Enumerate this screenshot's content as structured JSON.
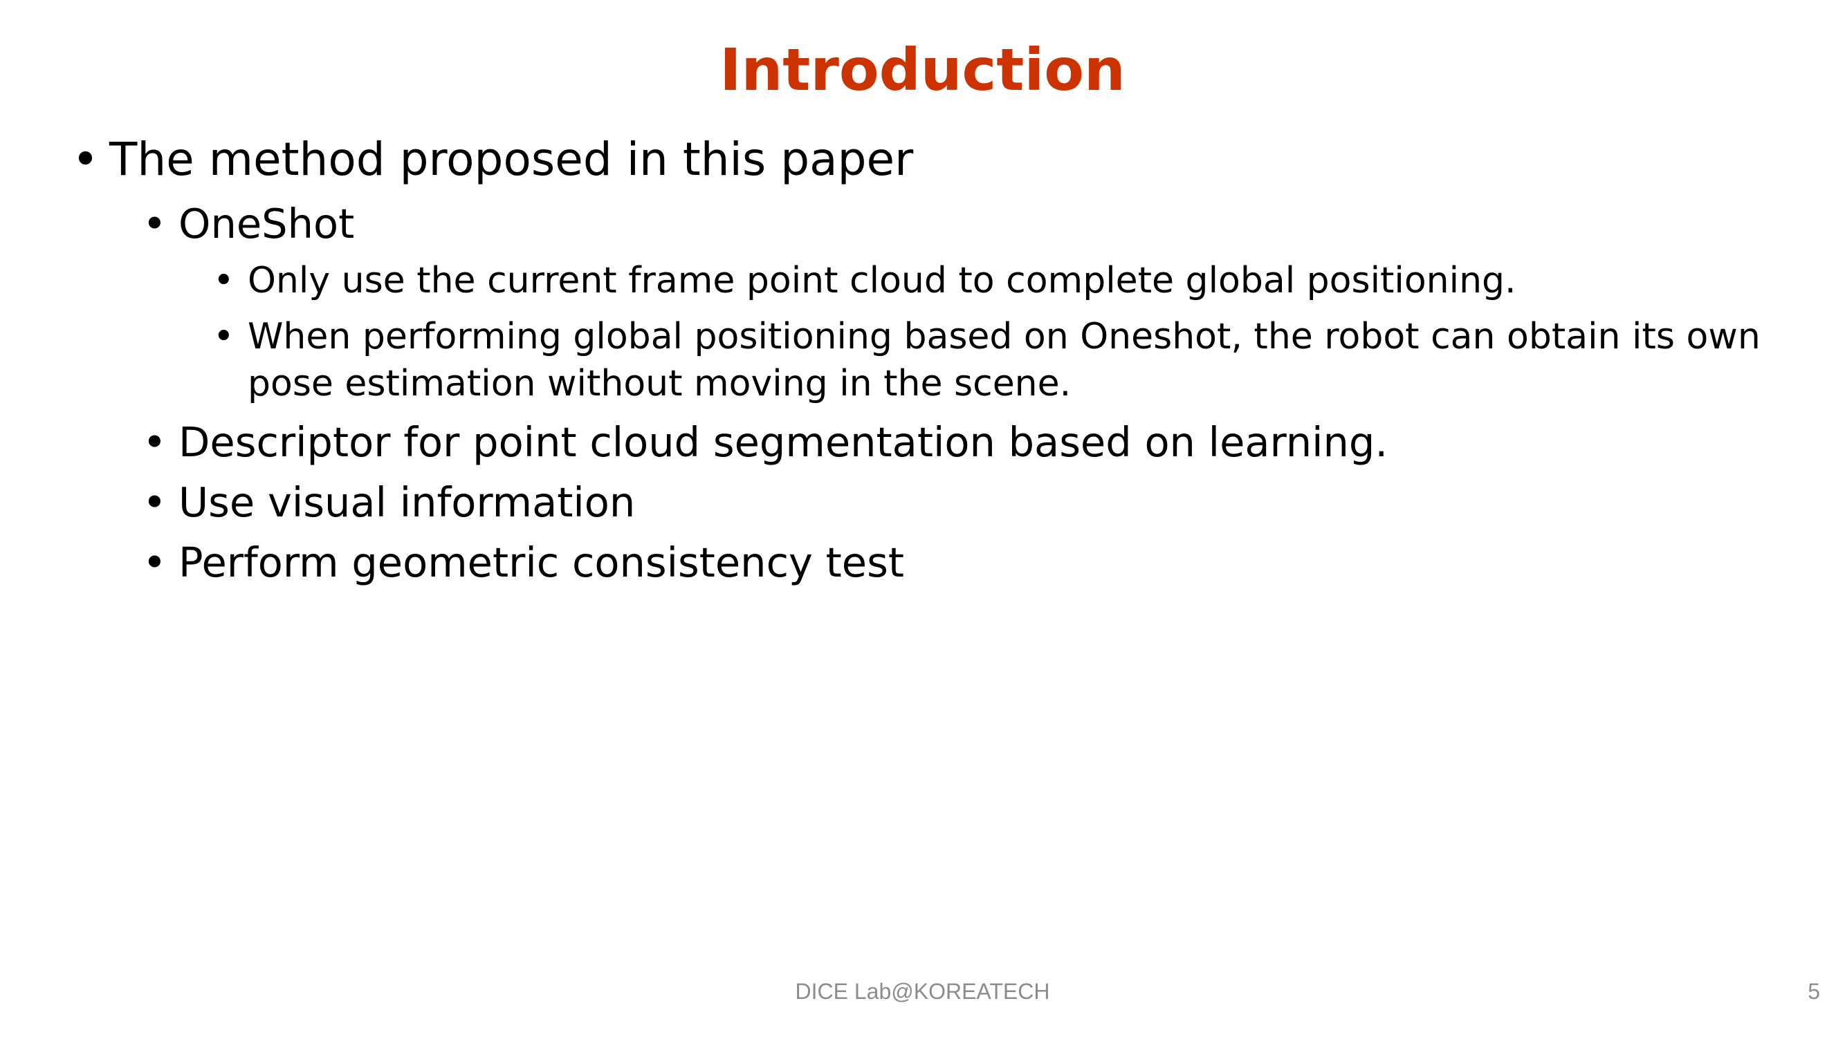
{
  "slide": {
    "title": "Introduction",
    "bullet_glyph": "•",
    "items": [
      {
        "level": 1,
        "text": "The method proposed in this paper"
      },
      {
        "level": 2,
        "text": "OneShot"
      },
      {
        "level": 3,
        "text": "Only use the current frame point cloud to complete global positioning."
      },
      {
        "level": 3,
        "text": "When performing global positioning based on Oneshot, the robot can obtain its own",
        "continuation": "pose estimation without moving in the scene."
      },
      {
        "level": 2,
        "text": "Descriptor for point cloud segmentation based on learning."
      },
      {
        "level": 2,
        "text": "Use visual information"
      },
      {
        "level": 2,
        "text": "Perform geometric consistency test"
      }
    ],
    "footer": "DICE Lab@KOREATECH",
    "page_number": "5"
  },
  "colors": {
    "title": "#cc3300",
    "body_text": "#000000",
    "footer": "#8c8c8c",
    "background": "#ffffff"
  }
}
